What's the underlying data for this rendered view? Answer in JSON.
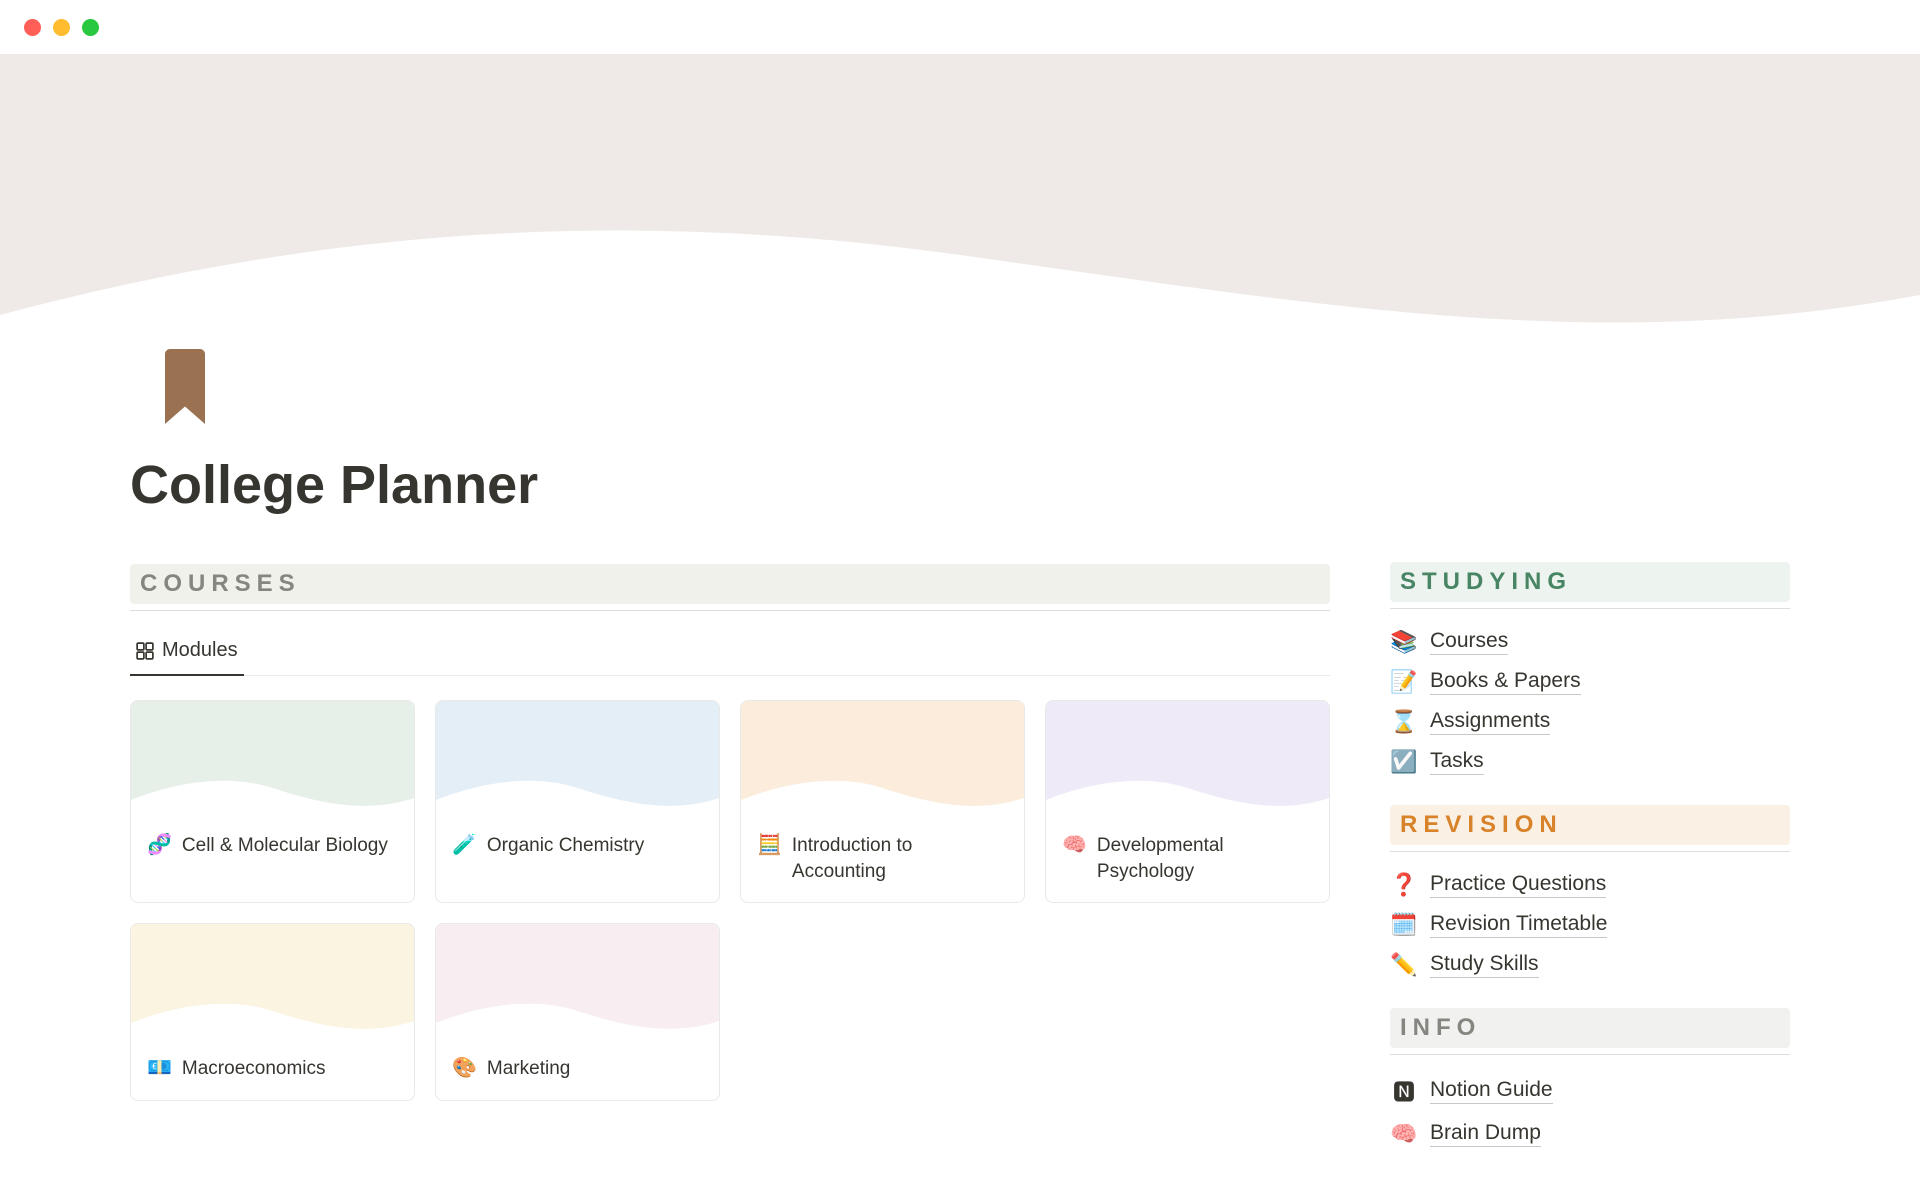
{
  "page": {
    "title": "College Planner"
  },
  "sections": {
    "courses": {
      "label": "COURSES"
    },
    "studying": {
      "label": "STUDYING"
    },
    "revision": {
      "label": "REVISION"
    },
    "info": {
      "label": "INFO"
    }
  },
  "tabs": {
    "modules": "Modules"
  },
  "modules": [
    {
      "emoji": "🧬",
      "title": "Cell & Molecular Biology",
      "cover": "cov-green"
    },
    {
      "emoji": "🧪",
      "title": "Organic Chemistry",
      "cover": "cov-blue"
    },
    {
      "emoji": "🧮",
      "title": "Introduction to Accounting",
      "cover": "cov-orange"
    },
    {
      "emoji": "🧠",
      "title": "Developmental Psychology",
      "cover": "cov-purple"
    },
    {
      "emoji": "💶",
      "title": "Macroeconomics",
      "cover": "cov-yellow"
    },
    {
      "emoji": "🎨",
      "title": "Marketing",
      "cover": "cov-pink"
    }
  ],
  "studying_links": [
    {
      "emoji": "📚",
      "label": "Courses"
    },
    {
      "emoji": "📝",
      "label": "Books & Papers"
    },
    {
      "emoji": "⌛",
      "label": "Assignments"
    },
    {
      "emoji": "☑️",
      "label": "Tasks"
    }
  ],
  "revision_links": [
    {
      "emoji": "❓",
      "label": "Practice Questions"
    },
    {
      "emoji": "🗓️",
      "label": "Revision Timetable"
    },
    {
      "emoji": "✏️",
      "label": "Study Skills"
    }
  ],
  "info_links": [
    {
      "emoji": "🅽",
      "label": "Notion Guide"
    },
    {
      "emoji": "🧠",
      "label": "Brain Dump"
    }
  ]
}
